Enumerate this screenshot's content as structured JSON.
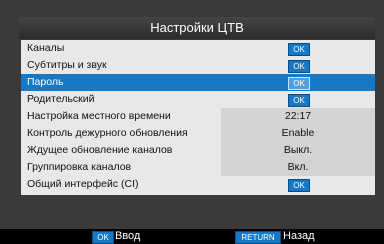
{
  "title": "Настройки ЦТВ",
  "menu": [
    {
      "label": "Каналы",
      "value": "OK",
      "type": "button"
    },
    {
      "label": "Субтитры и звук",
      "value": "OK",
      "type": "button"
    },
    {
      "label": "Пароль",
      "value": "OK",
      "type": "button",
      "selected": true
    },
    {
      "label": "Родительский",
      "value": "OK",
      "type": "button"
    },
    {
      "label": "Настройка местного времени",
      "value": "22:17",
      "type": "text"
    },
    {
      "label": "Контроль дежурного обновления",
      "value": "Enable",
      "type": "text"
    },
    {
      "label": "Ждущее обновление каналов",
      "value": "Выкл.",
      "type": "text"
    },
    {
      "label": "Группировка каналов",
      "value": "Вкл.",
      "type": "text"
    },
    {
      "label": "Общий интерфейс (CI)",
      "value": "OK",
      "type": "button"
    }
  ],
  "footer": {
    "ok_key": "OK",
    "ok_label": "Ввод",
    "return_key": "RETURN",
    "return_label": "Назад"
  },
  "colors": {
    "accent": "#1778c5",
    "menu_background": "#e8e8e8",
    "panel_background": "#3a3a3a"
  }
}
